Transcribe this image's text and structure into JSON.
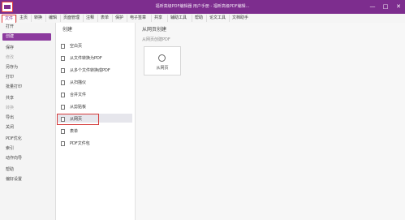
{
  "window": {
    "title": "福昕高级PDF编辑器 用户手册 - 福昕高级PDF编辑...",
    "controls": [
      "—",
      "□",
      "✕"
    ]
  },
  "menubar": {
    "items": [
      "文件",
      "主页",
      "转换",
      "编辑",
      "页面管理",
      "注释",
      "表单",
      "保护",
      "电子签章",
      "共享",
      "辅助工具",
      "帮助",
      "论文工具",
      "文档助手"
    ]
  },
  "sidebar": {
    "items": [
      {
        "label": "打开",
        "state": "normal"
      },
      {
        "label": "创建",
        "state": "selected"
      },
      {
        "label": "保存",
        "state": "normal"
      },
      {
        "label": "修改",
        "state": "dim"
      },
      {
        "label": "另存为",
        "state": "normal"
      },
      {
        "label": "打印",
        "state": "normal"
      },
      {
        "label": "批量打印",
        "state": "normal"
      },
      {
        "label": "共享",
        "state": "normal"
      },
      {
        "label": "转换",
        "state": "dim"
      },
      {
        "label": "导出",
        "state": "normal"
      },
      {
        "label": "关闭",
        "state": "normal"
      },
      {
        "label": "PDF优化",
        "state": "normal"
      },
      {
        "label": "索引",
        "state": "normal"
      },
      {
        "label": "动作向导",
        "state": "normal"
      },
      {
        "label": "帮助",
        "state": "normal"
      },
      {
        "label": "偏好设置",
        "state": "normal"
      }
    ]
  },
  "create_panel": {
    "heading": "创建",
    "items": [
      {
        "label": "空白页",
        "icon": "blank-page-icon"
      },
      {
        "label": "从文件转换为PDF",
        "icon": "file-convert-icon"
      },
      {
        "label": "从多个文件转换成PDF",
        "icon": "multi-file-icon"
      },
      {
        "label": "从扫描仪",
        "icon": "scanner-icon"
      },
      {
        "label": "合并文件",
        "icon": "merge-icon"
      },
      {
        "label": "从剪贴板",
        "icon": "clipboard-icon"
      },
      {
        "label": "从网页",
        "icon": "web-icon"
      },
      {
        "label": "表单",
        "icon": "form-icon"
      },
      {
        "label": "PDF文件包",
        "icon": "portfolio-icon"
      }
    ]
  },
  "web_panel": {
    "heading": "从网页创建",
    "subheading": "从网页创建PDF",
    "card_label": "从网页"
  },
  "colors": {
    "accent": "#7d2d8e",
    "selection": "#8c3a9e",
    "highlight": "#d43a3a"
  }
}
